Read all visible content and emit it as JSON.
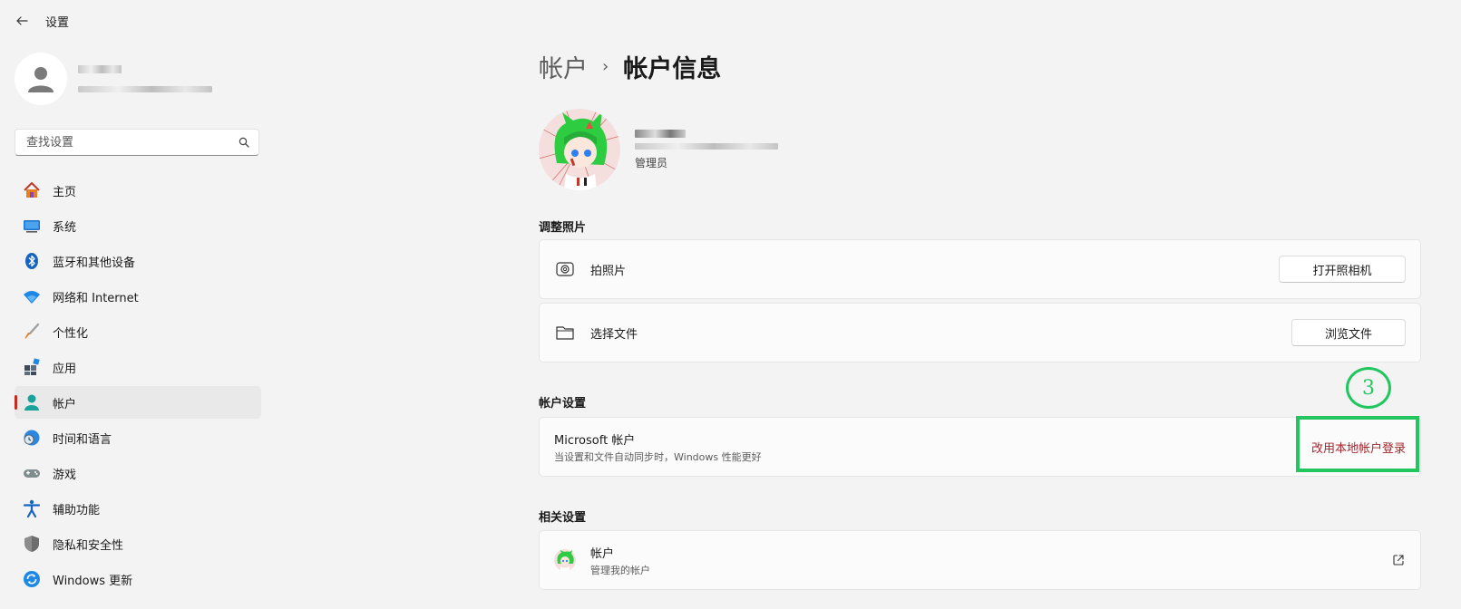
{
  "window": {
    "title": "设置"
  },
  "sidebar": {
    "search": {
      "placeholder": "查找设置"
    },
    "items": [
      {
        "label": "主页",
        "icon": "home-icon"
      },
      {
        "label": "系统",
        "icon": "system-icon"
      },
      {
        "label": "蓝牙和其他设备",
        "icon": "bluetooth-icon"
      },
      {
        "label": "网络和 Internet",
        "icon": "network-icon"
      },
      {
        "label": "个性化",
        "icon": "brush-icon"
      },
      {
        "label": "应用",
        "icon": "apps-icon"
      },
      {
        "label": "帐户",
        "icon": "account-icon",
        "active": true
      },
      {
        "label": "时间和语言",
        "icon": "time-language-icon"
      },
      {
        "label": "游戏",
        "icon": "gaming-icon"
      },
      {
        "label": "辅助功能",
        "icon": "accessibility-icon"
      },
      {
        "label": "隐私和安全性",
        "icon": "shield-icon"
      },
      {
        "label": "Windows 更新",
        "icon": "update-icon"
      }
    ]
  },
  "main": {
    "breadcrumb": {
      "parent": "帐户",
      "separator": "›",
      "current": "帐户信息"
    },
    "account": {
      "role": "管理员"
    },
    "adjust_photo": {
      "title": "调整照片",
      "take_photo": {
        "label": "拍照片",
        "button": "打开照相机",
        "icon": "camera-icon"
      },
      "choose_file": {
        "label": "选择文件",
        "button": "浏览文件",
        "icon": "folder-icon"
      }
    },
    "account_settings": {
      "title": "帐户设置",
      "microsoft": {
        "label": "Microsoft 帐户",
        "description": "当设置和文件自动同步时，Windows 性能更好",
        "link": "改用本地帐户登录"
      }
    },
    "related": {
      "title": "相关设置",
      "accounts": {
        "label": "帐户",
        "description": "管理我的帐户",
        "icon": "external-link-icon"
      }
    }
  },
  "annotation": {
    "step": "3",
    "color": "#22c55e"
  },
  "colors": {
    "accent": "#c42b1c",
    "link": "#a4262c",
    "background": "#f3f3f3"
  }
}
